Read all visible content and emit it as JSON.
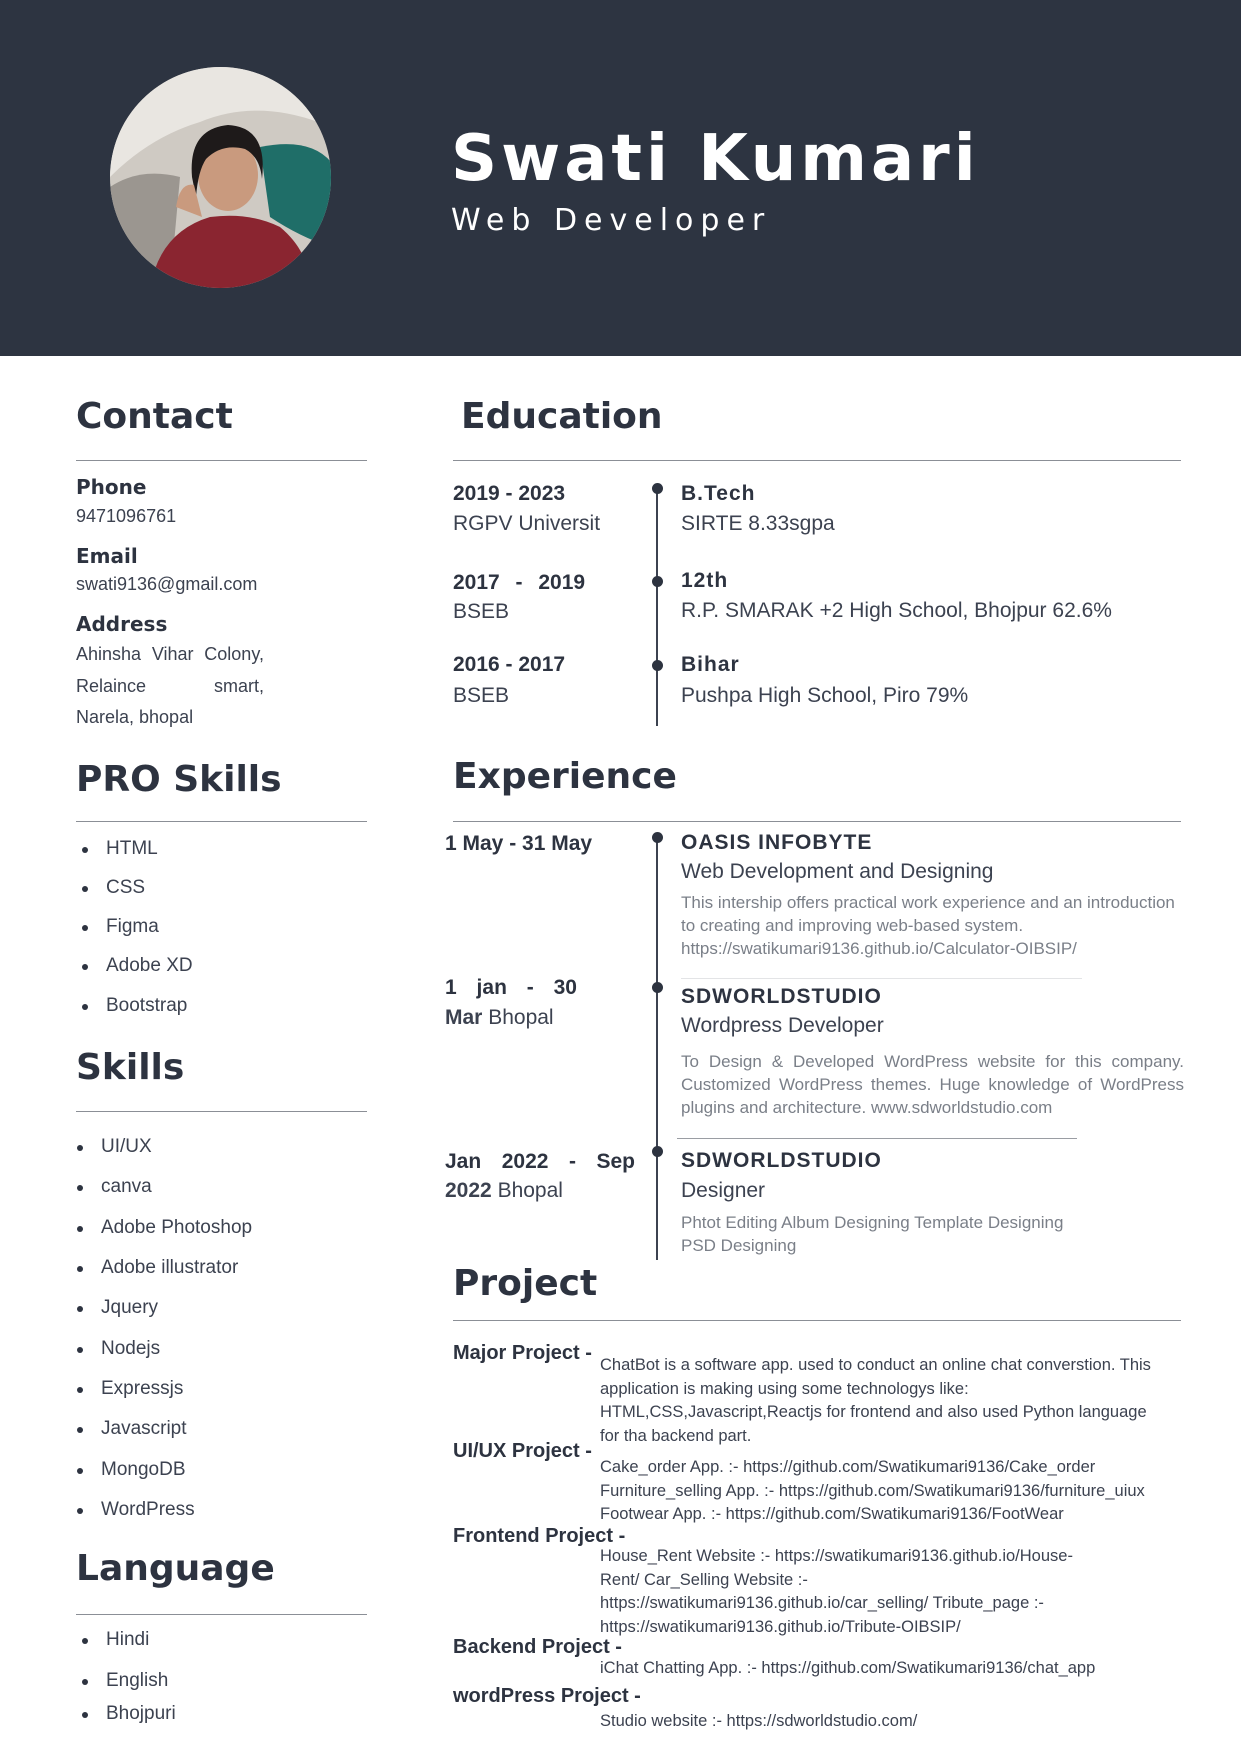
{
  "header": {
    "name": "Swati Kumari",
    "role": "Web Developer",
    "background_color": "#2d3441"
  },
  "contact": {
    "title": "Contact",
    "phone_label": "Phone",
    "phone": "9471096761",
    "email_label": "Email",
    "email": "swati9136@gmail.com",
    "address_label": "Address",
    "address_lines": [
      "Ahinsha Vihar Colony,",
      "Relaince smart,",
      "Narela, bhopal"
    ]
  },
  "pro_skills": {
    "title": "PRO Skills",
    "items": [
      "HTML",
      "CSS",
      "Figma",
      "Adobe XD",
      "Bootstrap"
    ]
  },
  "skills": {
    "title": "Skills",
    "items": [
      "UI/UX",
      "canva",
      "Adobe Photoshop",
      "Adobe illustrator",
      "Jquery",
      "Nodejs",
      "Expressjs",
      "Javascript",
      "MongoDB",
      "WordPress"
    ]
  },
  "language": {
    "title": "Language",
    "items": [
      "Hindi",
      "English",
      "Bhojpuri"
    ]
  },
  "education": {
    "title": "Education",
    "entries": [
      {
        "years": "2019 - 2023",
        "board": "RGPV Universit",
        "degree": "B.Tech",
        "detail": "SIRTE 8.33sgpa"
      },
      {
        "years": "2017 - 2019",
        "board": "BSEB",
        "degree": "12th",
        "detail": "R.P. SMARAK +2 High School, Bhojpur 62.6%"
      },
      {
        "years": "2016 - 2017",
        "board": "BSEB",
        "degree": "Bihar",
        "detail": "Pushpa High School, Piro 79%"
      }
    ]
  },
  "experience": {
    "title": "Experience",
    "entries": [
      {
        "date_bold": "1 May - 31 May",
        "date_rest": "",
        "company": "OASIS INFOBYTE",
        "position": "Web Development and Designing",
        "desc": "This intership offers practical work experience and an introduction to creating and improving web-based system. https://swatikumari9136.github.io/Calculator-OIBSIP/"
      },
      {
        "date_line1": "1 jan - 30",
        "date_bold2": "Mar",
        "date_rest2": "Bhopal",
        "company": "SDWORLDSTUDIO",
        "position": "Wordpress Developer",
        "desc": "To Design & Developed WordPress website for this company. Customized WordPress themes. Huge knowledge of WordPress plugins and architecture. www.sdworldstudio.com"
      },
      {
        "date_line1": "Jan 2022 - Sep",
        "date_bold2": "2022",
        "date_rest2": "Bhopal",
        "company": "SDWORLDSTUDIO",
        "position": "Designer",
        "desc": "Phtot Editing Album Designing Template Designing PSD Designing"
      }
    ]
  },
  "project": {
    "title": "Project",
    "entries": [
      {
        "label": "Major Project -",
        "text": "ChatBot is a software app. used to conduct an online chat converstion. This application is making using some technologys like: HTML,CSS,Javascript,Reactjs for frontend and also used Python language for tha backend part."
      },
      {
        "label": "UI/UX Project -",
        "text": "Cake_order App. :- https://github.com/Swatikumari9136/Cake_order Furniture_selling App. :- https://github.com/Swatikumari9136/furniture_uiux Footwear App. :- https://github.com/Swatikumari9136/FootWear"
      },
      {
        "label": "Frontend Project -",
        "text": "House_Rent Website :- https://swatikumari9136.github.io/House-Rent/ Car_Selling Website :- https://swatikumari9136.github.io/car_selling/ Tribute_page :- https://swatikumari9136.github.io/Tribute-OIBSIP/"
      },
      {
        "label": "Backend Project -",
        "text": "iChat Chatting App. :- https://github.com/Swatikumari9136/chat_app"
      },
      {
        "label": "wordPress Project -",
        "text": "Studio website :- https://sdworldstudio.com/"
      }
    ]
  }
}
